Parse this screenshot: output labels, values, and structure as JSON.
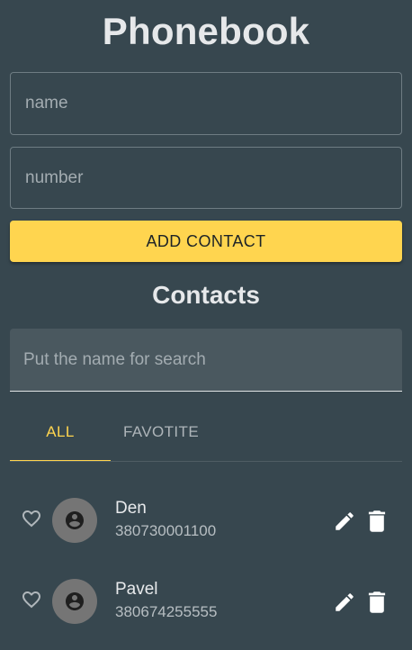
{
  "app": {
    "title": "Phonebook"
  },
  "form": {
    "name_placeholder": "name",
    "number_placeholder": "number",
    "add_button": "ADD CONTACT"
  },
  "contacts_section": {
    "title": "Contacts",
    "search_placeholder": "Put the name for search",
    "tabs": [
      {
        "label": "ALL",
        "active": true
      },
      {
        "label": "FAVOTITE",
        "active": false
      }
    ]
  },
  "contacts": [
    {
      "name": "Den",
      "number": "380730001100",
      "favorite": false,
      "icons": [
        "heart-outline-icon",
        "account-circle-icon",
        "pencil-icon",
        "trash-icon"
      ]
    },
    {
      "name": "Pavel",
      "number": "380674255555",
      "favorite": false,
      "icons": [
        "heart-outline-icon",
        "account-circle-icon",
        "pencil-icon",
        "trash-icon"
      ]
    }
  ],
  "colors": {
    "background": "#37474f",
    "accent": "#ffd54f",
    "avatar": "#757575"
  }
}
